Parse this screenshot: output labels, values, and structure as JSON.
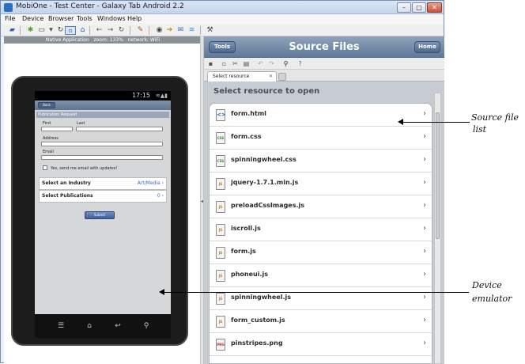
{
  "window": {
    "title": "MobiOne - Test Center - Galaxy Tab Android 2.2",
    "controls": {
      "minimize": "–",
      "maximize": "□",
      "close": "✕"
    }
  },
  "menu": [
    "File",
    "Device",
    "Browser",
    "Tools",
    "Windows",
    "Help"
  ],
  "status_strip": "Native Application   zoom: 133%   network: WiFi",
  "device": {
    "time": "17:15",
    "back_label": "Back",
    "form_title": "Publication Request",
    "first_label": "First",
    "last_label": "Last",
    "address_label": "Address",
    "email_label": "Email",
    "checkbox_label": "Yes, send me email with updates!",
    "industry_label": "Select an Industry",
    "industry_value": "Art/Media",
    "publications_label": "Select Publications",
    "publications_value": "0",
    "submit_label": "Submit"
  },
  "panel": {
    "tools_label": "Tools",
    "title": "Source Files",
    "home_label": "Home",
    "tab_label": "Select resource",
    "heading": "Select resource to open",
    "files": [
      {
        "name": "form.html",
        "type": "html",
        "badge": "<>"
      },
      {
        "name": "form.css",
        "type": "css",
        "badge": "CSS"
      },
      {
        "name": "spinningwheel.css",
        "type": "css",
        "badge": "CSS"
      },
      {
        "name": "jquery-1.7.1.min.js",
        "type": "js",
        "badge": "JS"
      },
      {
        "name": "preloadCssImages.js",
        "type": "js",
        "badge": "JS"
      },
      {
        "name": "iscroll.js",
        "type": "js",
        "badge": "JS"
      },
      {
        "name": "form.js",
        "type": "js",
        "badge": "JS"
      },
      {
        "name": "phoneui.js",
        "type": "js",
        "badge": "JS"
      },
      {
        "name": "spinningwheel.js",
        "type": "js",
        "badge": "JS"
      },
      {
        "name": "form_custom.js",
        "type": "js",
        "badge": "JS"
      },
      {
        "name": "pinstripes.png",
        "type": "png",
        "badge": "PNG"
      }
    ]
  },
  "annotations": {
    "source_list_line1": "Source file",
    "source_list_line2": "list",
    "device_line1": "Device",
    "device_line2": "emulator"
  }
}
